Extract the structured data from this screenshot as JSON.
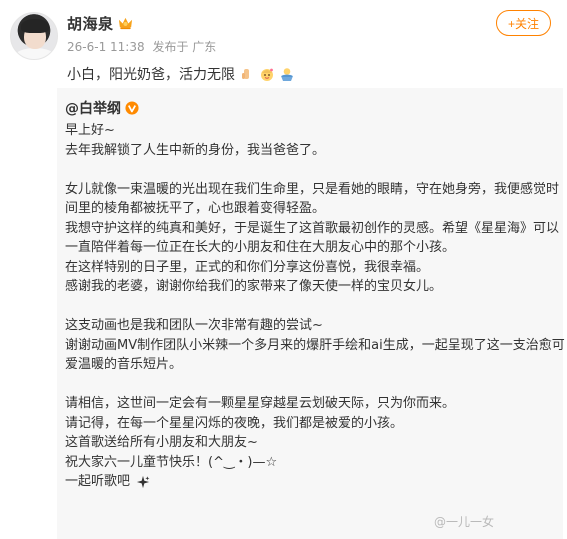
{
  "post": {
    "author": "胡海泉",
    "time": "26-6-1 11:38",
    "source": "发布于 广东",
    "follow_label": "+关注",
    "caption": "小白，阳光奶爸，活力无限",
    "verified_icon": "crown-icon",
    "caption_emojis": [
      "thumb-icon",
      "baby-face-icon",
      "baby-bath-icon"
    ]
  },
  "repost": {
    "author": "@白举纲",
    "verified_icon": "orange-v-badge-icon",
    "lines": [
      "早上好~",
      "去年我解锁了人生中新的身份，我当爸爸了。",
      "",
      "女儿就像一束温暖的光出现在我们生命里，只是看她的眼睛，守在她身旁，我便感觉时",
      "间里的棱角都被抚平了，心也跟着变得轻盈。",
      "我想守护这样的纯真和美好，于是诞生了这首歌最初创作的灵感。希望《星星海》可以",
      "一直陪伴着每一位正在长大的小朋友和住在大朋友心中的那个小孩。",
      "在这样特别的日子里，正式的和你们分享这份喜悦，我很幸福。",
      "感谢我的老婆，谢谢你给我们的家带来了像天使一样的宝贝女儿。",
      "",
      "这支动画也是我和团队一次非常有趣的尝试~",
      "谢谢动画MV制作团队小米辣一个多月来的爆肝手绘和ai生成，一起呈现了这一支治愈可",
      "爱温暖的音乐短片。",
      "",
      "请相信，这世间一定会有一颗星星穿越星云划破天际，只为你而来。",
      "请记得，在每一个星星闪烁的夜晚，我们都是被爱的小孩。",
      "这首歌送给所有小朋友和大朋友~",
      "祝大家六一儿童节快乐！(^‿・)—☆",
      "一起听歌吧"
    ],
    "last_line_icon": "sparkle-icon"
  },
  "watermark": "@一儿一女"
}
